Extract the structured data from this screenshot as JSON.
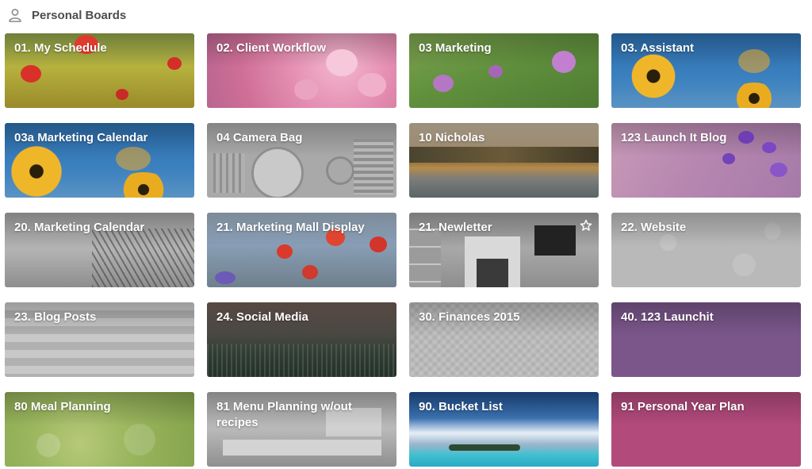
{
  "section": {
    "title": "Personal Boards",
    "icon": "person-icon"
  },
  "boards": [
    {
      "title": "01. My Schedule",
      "background": "red-poppy-meadow-photo"
    },
    {
      "title": "02. Client Workflow",
      "background": "pink-blossom-photo"
    },
    {
      "title": "03 Marketing",
      "background": "purple-flowers-green-photo"
    },
    {
      "title": "03. Assistant",
      "background": "yellow-flowers-blue-sky-photo"
    },
    {
      "title": "03a Marketing Calendar",
      "background": "yellow-flowers-blue-sky-photo"
    },
    {
      "title": "04 Camera Bag",
      "background": "camera-gear-flatlay-photo"
    },
    {
      "title": "10 Nicholas",
      "background": "lake-trees-landscape-photo"
    },
    {
      "title": "123 Launch It Blog",
      "background": "purple-wildflowers-photo"
    },
    {
      "title": "20. Marketing Calendar",
      "background": "grey-bare-tree-photo"
    },
    {
      "title": "21. Marketing Mall Display",
      "background": "red-wildflowers-photo"
    },
    {
      "title": "21. Newletter",
      "background": "living-room-fireplace-photo",
      "starred_icon": "star-outline-icon"
    },
    {
      "title": "22. Website",
      "background": "grey-floral-pattern"
    },
    {
      "title": "23. Blog Posts",
      "background": "grey-wave-pattern"
    },
    {
      "title": "24. Social Media",
      "background": "dark-grass-field-photo"
    },
    {
      "title": "30. Finances 2015",
      "background": "grey-chevron-pattern"
    },
    {
      "title": "40. 123 Launchit",
      "background": "solid-purple"
    },
    {
      "title": "80 Meal Planning",
      "background": "green-bokeh-photo"
    },
    {
      "title": "81 Menu Planning w/out recipes",
      "background": "kitchen-interior-photo"
    },
    {
      "title": "90. Bucket List",
      "background": "tropical-beach-photo"
    },
    {
      "title": "91 Personal Year Plan",
      "background": "solid-pink"
    }
  ],
  "colors": {
    "purple": "#7a568a",
    "pink": "#b24a7c",
    "grey_pattern": "#b9b9b9",
    "title_text": "#4d4d4d"
  }
}
